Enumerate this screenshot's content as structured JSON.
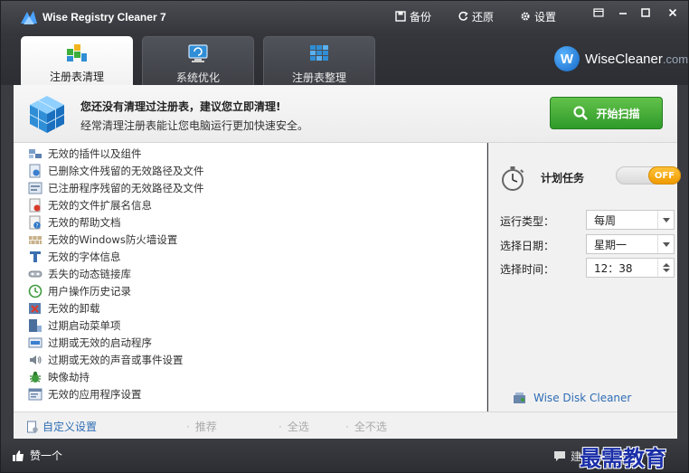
{
  "app": {
    "title": "Wise Registry Cleaner 7"
  },
  "titlebar": {
    "backup_label": "备份",
    "restore_label": "还原",
    "settings_label": "设置"
  },
  "tabs": [
    {
      "label": "注册表清理",
      "active": true
    },
    {
      "label": "系统优化",
      "active": false
    },
    {
      "label": "注册表整理",
      "active": false
    }
  ],
  "brand": {
    "name": "WiseCleaner",
    "domain": ".com",
    "logo_letter": "W"
  },
  "banner": {
    "headline": "您还没有清理过注册表，建议您立即清理!",
    "subtext": "经常清理注册表能让您电脑运行更加快速安全。",
    "scan_label": "开始扫描"
  },
  "scan_items": [
    {
      "label": "无效的插件以及组件",
      "icon": "plugin-icon"
    },
    {
      "label": "已删除文件残留的无效路径及文件",
      "icon": "deleted-file-icon"
    },
    {
      "label": "已注册程序残留的无效路径及文件",
      "icon": "registered-program-icon"
    },
    {
      "label": "无效的文件扩展名信息",
      "icon": "file-extension-icon"
    },
    {
      "label": "无效的帮助文档",
      "icon": "help-doc-icon"
    },
    {
      "label": "无效的Windows防火墙设置",
      "icon": "firewall-icon"
    },
    {
      "label": "无效的字体信息",
      "icon": "font-icon"
    },
    {
      "label": "丢失的动态链接库",
      "icon": "dll-icon"
    },
    {
      "label": "用户操作历史记录",
      "icon": "history-icon"
    },
    {
      "label": "无效的卸载",
      "icon": "uninstall-icon"
    },
    {
      "label": "过期启动菜单项",
      "icon": "start-menu-icon"
    },
    {
      "label": "过期或无效的启动程序",
      "icon": "startup-program-icon"
    },
    {
      "label": "过期或无效的声音或事件设置",
      "icon": "sound-icon"
    },
    {
      "label": "映像劫持",
      "icon": "bug-icon"
    },
    {
      "label": "无效的应用程序设置",
      "icon": "app-settings-icon"
    }
  ],
  "schedule": {
    "label": "计划任务",
    "toggle_state": "OFF",
    "run_type_label": "运行类型：",
    "run_type_value": "每周",
    "day_label": "选择日期：",
    "day_value": "星期一",
    "time_label": "选择时间：",
    "time_value": "12：38"
  },
  "disk_cleaner_label": "Wise Disk Cleaner",
  "action_bar": {
    "custom_settings_label": "自定义设置",
    "recommend_label": "推荐",
    "select_all_label": "全选",
    "select_none_label": "全不选"
  },
  "statusbar": {
    "like_label": "赞一个",
    "feedback_partial": "建"
  },
  "watermark": "最需教育",
  "colors": {
    "titlebar": "#34363b",
    "scan_button": "#3fa832",
    "toggle_knob": "#f5a800",
    "link": "#2e6db5"
  }
}
